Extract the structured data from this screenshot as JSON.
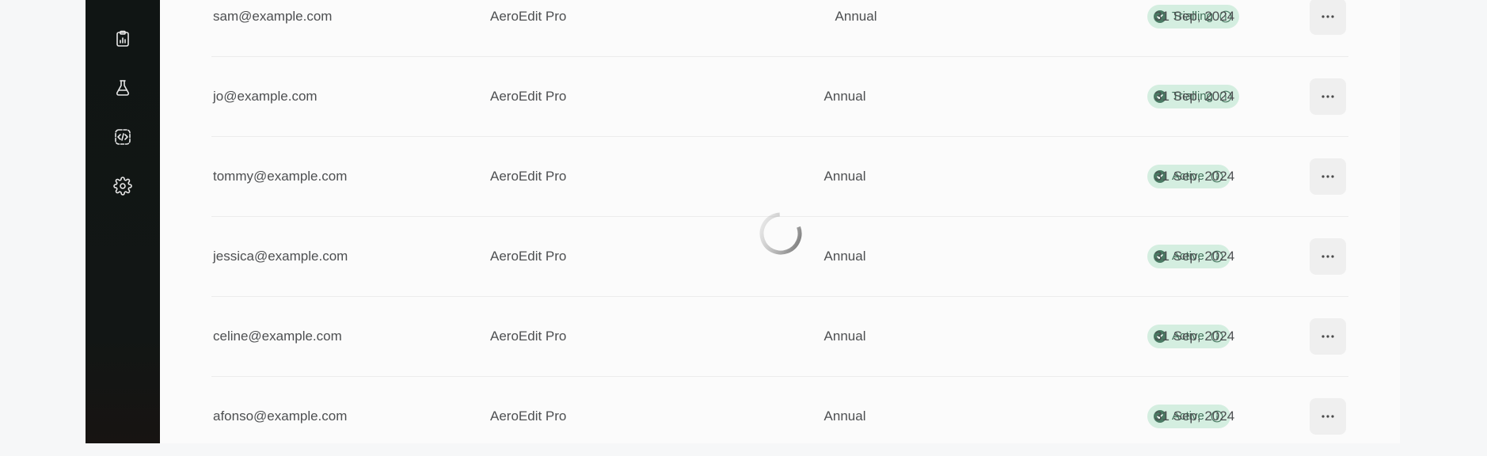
{
  "sidebar": {
    "items": [
      {
        "icon": "clipboard-chart-icon"
      },
      {
        "icon": "flask-icon"
      },
      {
        "icon": "code-icon"
      },
      {
        "icon": "gear-icon"
      }
    ]
  },
  "colors": {
    "sidebar_bg": "#111615",
    "badge_bg": "#d4eee0",
    "badge_text": "#3f6e58",
    "row_text": "#4d4f51"
  },
  "table": {
    "rows": [
      {
        "email": "sam@example.com",
        "product": "AeroEdit Pro",
        "plan": "Annual",
        "status": "Trialling",
        "date": "31 Sep, 2024"
      },
      {
        "email": "jo@example.com",
        "product": "AeroEdit Pro",
        "plan": "Annual",
        "status": "Trialling",
        "date": "31 Sep, 2024"
      },
      {
        "email": "tommy@example.com",
        "product": "AeroEdit Pro",
        "plan": "Annual",
        "status": "Active",
        "date": "31 Sep, 2024"
      },
      {
        "email": "jessica@example.com",
        "product": "AeroEdit Pro",
        "plan": "Annual",
        "status": "Active",
        "date": "31 Sep, 2024"
      },
      {
        "email": "celine@example.com",
        "product": "AeroEdit Pro",
        "plan": "Annual",
        "status": "Active",
        "date": "31 Sep, 2024"
      },
      {
        "email": "afonso@example.com",
        "product": "AeroEdit Pro",
        "plan": "Annual",
        "status": "Active",
        "date": "31 Sep, 2024"
      }
    ]
  },
  "loading": {
    "icon": "loading-spinner-icon"
  }
}
